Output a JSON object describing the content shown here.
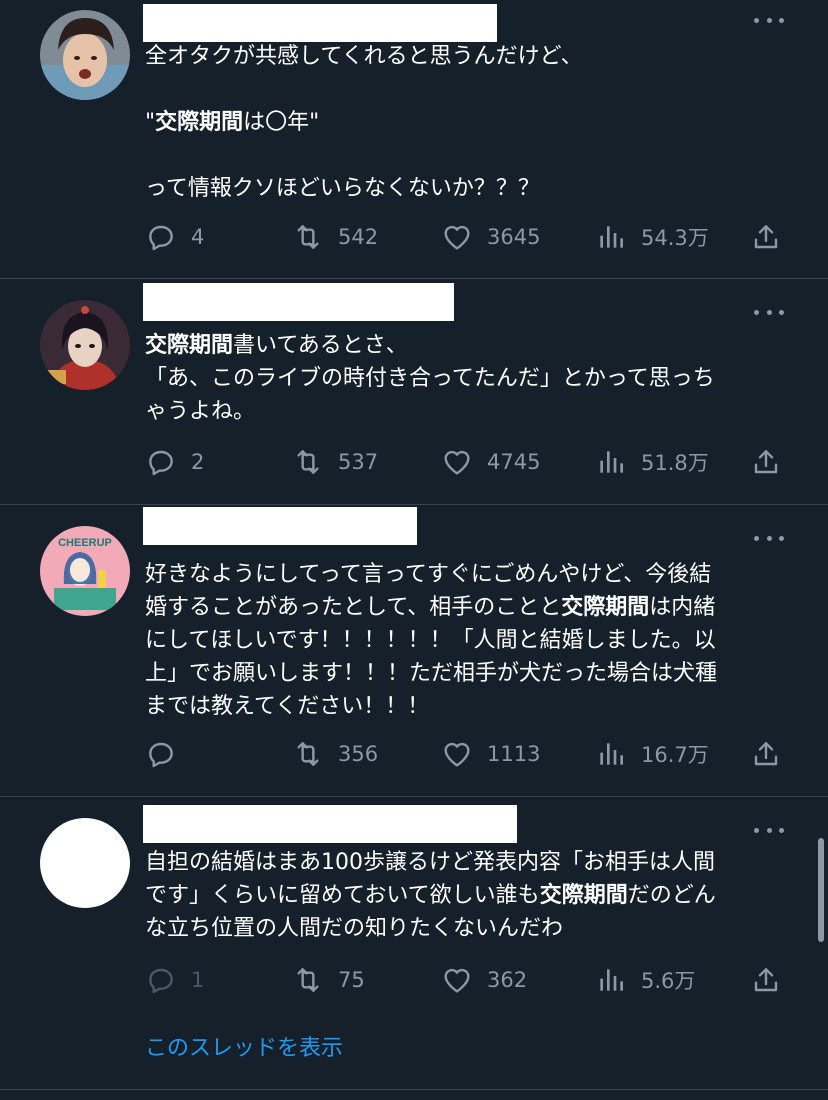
{
  "tweets": [
    {
      "avatar": "avatar-1",
      "body": [
        {
          "t": "全オタクが共感してくれると思うんだけど、\n\n"
        },
        {
          "t": "\"",
          "b": false
        },
        {
          "t": "交際期間",
          "b": true
        },
        {
          "t": "は〇年\"\n\nって情報クソほどいらなくないか？？？"
        }
      ],
      "replies": "4",
      "retweets": "542",
      "likes": "3645",
      "views": "54.3万"
    },
    {
      "avatar": "avatar-2",
      "body": [
        {
          "t": "交際期間",
          "b": true
        },
        {
          "t": "書いてあるとさ、\n「あ、このライブの時付き合ってたんだ」とかって思っち\nゃうよね。"
        }
      ],
      "replies": "2",
      "retweets": "537",
      "likes": "4745",
      "views": "51.8万"
    },
    {
      "avatar": "avatar-3",
      "avatar_text": "CHEERUP",
      "body": [
        {
          "t": "好きなようにしてって言ってすぐにごめんやけど、今後結\n婚することがあったとして、相手のことと"
        },
        {
          "t": "交際期間",
          "b": true
        },
        {
          "t": "は内緒\nにしてほしいです！！！！！！「人間と結婚しました。以\n上」でお願いします！！！ただ相手が犬だった場合は犬種\nまでは教えてください！！！"
        }
      ],
      "replies": "",
      "retweets": "356",
      "likes": "1113",
      "views": "16.7万"
    },
    {
      "avatar": "avatar-4",
      "body": [
        {
          "t": "自担の結婚はまあ100歩譲るけど発表内容「お相手は人間\nです」くらいに留めておいて欲しい誰も"
        },
        {
          "t": "交際期間",
          "b": true
        },
        {
          "t": "だのどん\nな立ち位置の人間だの知りたくないんだわ"
        }
      ],
      "replies": "1",
      "retweets": "75",
      "likes": "362",
      "views": "5.6万"
    }
  ],
  "show_thread": "このスレッドを表示",
  "colors": {
    "background": "#15202b",
    "text": "#ffffff",
    "muted": "#8b98a5",
    "link": "#1d9bf0",
    "divider": "#38444d"
  },
  "icons": [
    "reply-icon",
    "retweet-icon",
    "like-icon",
    "views-icon",
    "share-icon",
    "more-icon"
  ]
}
